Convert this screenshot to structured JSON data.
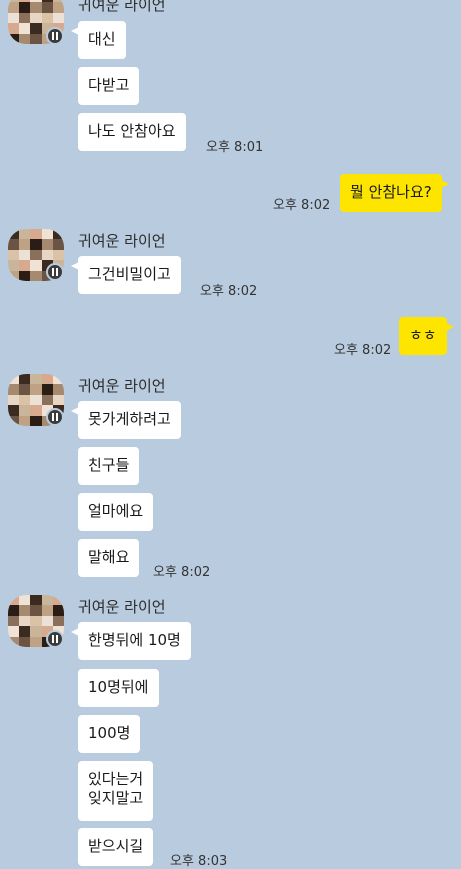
{
  "groups": [
    {
      "sender": "귀여운 라이언",
      "messages": [
        "대신",
        "다받고",
        "나도 안참아요"
      ],
      "time": "오후 8:01"
    },
    {
      "sender": "귀여운 라이언",
      "messages": [
        "그건비밀이고"
      ],
      "time": "오후 8:02"
    },
    {
      "sender": "귀여운 라이언",
      "messages": [
        "못가게하려고",
        "친구들",
        "얼마에요",
        "말해요"
      ],
      "time": "오후 8:02"
    },
    {
      "sender": "귀여운 라이언",
      "messages": [
        "한명뒤에 10명",
        "10명뒤에",
        "100명",
        "있다는거\n잊지말고",
        "받으시길"
      ],
      "time": "오후 8:03"
    }
  ],
  "mine": [
    {
      "text": "뭘 안참나요?",
      "time": "오후 8:02"
    },
    {
      "text": "ㅎㅎ",
      "time": "오후 8:02"
    }
  ],
  "colors": {
    "background": "#b9cbdf",
    "mine_bubble": "#fee500",
    "their_bubble": "#ffffff"
  }
}
